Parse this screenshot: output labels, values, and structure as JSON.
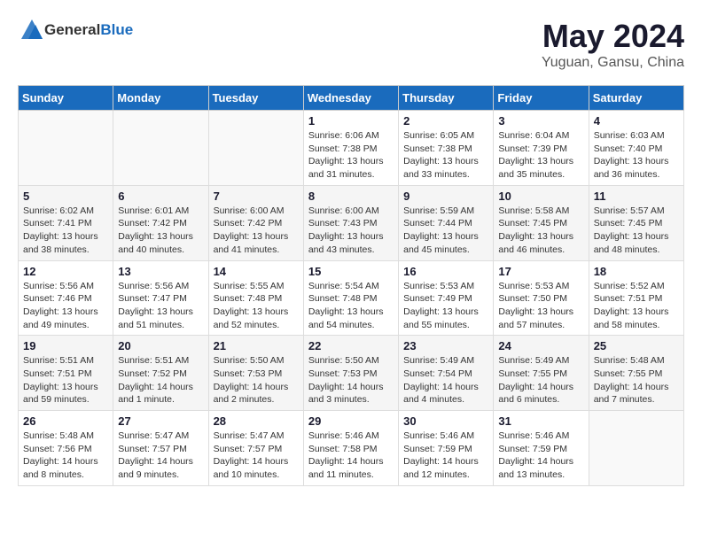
{
  "logo": {
    "general": "General",
    "blue": "Blue"
  },
  "title": "May 2024",
  "subtitle": "Yuguan, Gansu, China",
  "days_header": [
    "Sunday",
    "Monday",
    "Tuesday",
    "Wednesday",
    "Thursday",
    "Friday",
    "Saturday"
  ],
  "weeks": [
    [
      {
        "day": "",
        "info": ""
      },
      {
        "day": "",
        "info": ""
      },
      {
        "day": "",
        "info": ""
      },
      {
        "day": "1",
        "info": "Sunrise: 6:06 AM\nSunset: 7:38 PM\nDaylight: 13 hours\nand 31 minutes."
      },
      {
        "day": "2",
        "info": "Sunrise: 6:05 AM\nSunset: 7:38 PM\nDaylight: 13 hours\nand 33 minutes."
      },
      {
        "day": "3",
        "info": "Sunrise: 6:04 AM\nSunset: 7:39 PM\nDaylight: 13 hours\nand 35 minutes."
      },
      {
        "day": "4",
        "info": "Sunrise: 6:03 AM\nSunset: 7:40 PM\nDaylight: 13 hours\nand 36 minutes."
      }
    ],
    [
      {
        "day": "5",
        "info": "Sunrise: 6:02 AM\nSunset: 7:41 PM\nDaylight: 13 hours\nand 38 minutes."
      },
      {
        "day": "6",
        "info": "Sunrise: 6:01 AM\nSunset: 7:42 PM\nDaylight: 13 hours\nand 40 minutes."
      },
      {
        "day": "7",
        "info": "Sunrise: 6:00 AM\nSunset: 7:42 PM\nDaylight: 13 hours\nand 41 minutes."
      },
      {
        "day": "8",
        "info": "Sunrise: 6:00 AM\nSunset: 7:43 PM\nDaylight: 13 hours\nand 43 minutes."
      },
      {
        "day": "9",
        "info": "Sunrise: 5:59 AM\nSunset: 7:44 PM\nDaylight: 13 hours\nand 45 minutes."
      },
      {
        "day": "10",
        "info": "Sunrise: 5:58 AM\nSunset: 7:45 PM\nDaylight: 13 hours\nand 46 minutes."
      },
      {
        "day": "11",
        "info": "Sunrise: 5:57 AM\nSunset: 7:45 PM\nDaylight: 13 hours\nand 48 minutes."
      }
    ],
    [
      {
        "day": "12",
        "info": "Sunrise: 5:56 AM\nSunset: 7:46 PM\nDaylight: 13 hours\nand 49 minutes."
      },
      {
        "day": "13",
        "info": "Sunrise: 5:56 AM\nSunset: 7:47 PM\nDaylight: 13 hours\nand 51 minutes."
      },
      {
        "day": "14",
        "info": "Sunrise: 5:55 AM\nSunset: 7:48 PM\nDaylight: 13 hours\nand 52 minutes."
      },
      {
        "day": "15",
        "info": "Sunrise: 5:54 AM\nSunset: 7:48 PM\nDaylight: 13 hours\nand 54 minutes."
      },
      {
        "day": "16",
        "info": "Sunrise: 5:53 AM\nSunset: 7:49 PM\nDaylight: 13 hours\nand 55 minutes."
      },
      {
        "day": "17",
        "info": "Sunrise: 5:53 AM\nSunset: 7:50 PM\nDaylight: 13 hours\nand 57 minutes."
      },
      {
        "day": "18",
        "info": "Sunrise: 5:52 AM\nSunset: 7:51 PM\nDaylight: 13 hours\nand 58 minutes."
      }
    ],
    [
      {
        "day": "19",
        "info": "Sunrise: 5:51 AM\nSunset: 7:51 PM\nDaylight: 13 hours\nand 59 minutes."
      },
      {
        "day": "20",
        "info": "Sunrise: 5:51 AM\nSunset: 7:52 PM\nDaylight: 14 hours\nand 1 minute."
      },
      {
        "day": "21",
        "info": "Sunrise: 5:50 AM\nSunset: 7:53 PM\nDaylight: 14 hours\nand 2 minutes."
      },
      {
        "day": "22",
        "info": "Sunrise: 5:50 AM\nSunset: 7:53 PM\nDaylight: 14 hours\nand 3 minutes."
      },
      {
        "day": "23",
        "info": "Sunrise: 5:49 AM\nSunset: 7:54 PM\nDaylight: 14 hours\nand 4 minutes."
      },
      {
        "day": "24",
        "info": "Sunrise: 5:49 AM\nSunset: 7:55 PM\nDaylight: 14 hours\nand 6 minutes."
      },
      {
        "day": "25",
        "info": "Sunrise: 5:48 AM\nSunset: 7:55 PM\nDaylight: 14 hours\nand 7 minutes."
      }
    ],
    [
      {
        "day": "26",
        "info": "Sunrise: 5:48 AM\nSunset: 7:56 PM\nDaylight: 14 hours\nand 8 minutes."
      },
      {
        "day": "27",
        "info": "Sunrise: 5:47 AM\nSunset: 7:57 PM\nDaylight: 14 hours\nand 9 minutes."
      },
      {
        "day": "28",
        "info": "Sunrise: 5:47 AM\nSunset: 7:57 PM\nDaylight: 14 hours\nand 10 minutes."
      },
      {
        "day": "29",
        "info": "Sunrise: 5:46 AM\nSunset: 7:58 PM\nDaylight: 14 hours\nand 11 minutes."
      },
      {
        "day": "30",
        "info": "Sunrise: 5:46 AM\nSunset: 7:59 PM\nDaylight: 14 hours\nand 12 minutes."
      },
      {
        "day": "31",
        "info": "Sunrise: 5:46 AM\nSunset: 7:59 PM\nDaylight: 14 hours\nand 13 minutes."
      },
      {
        "day": "",
        "info": ""
      }
    ]
  ]
}
